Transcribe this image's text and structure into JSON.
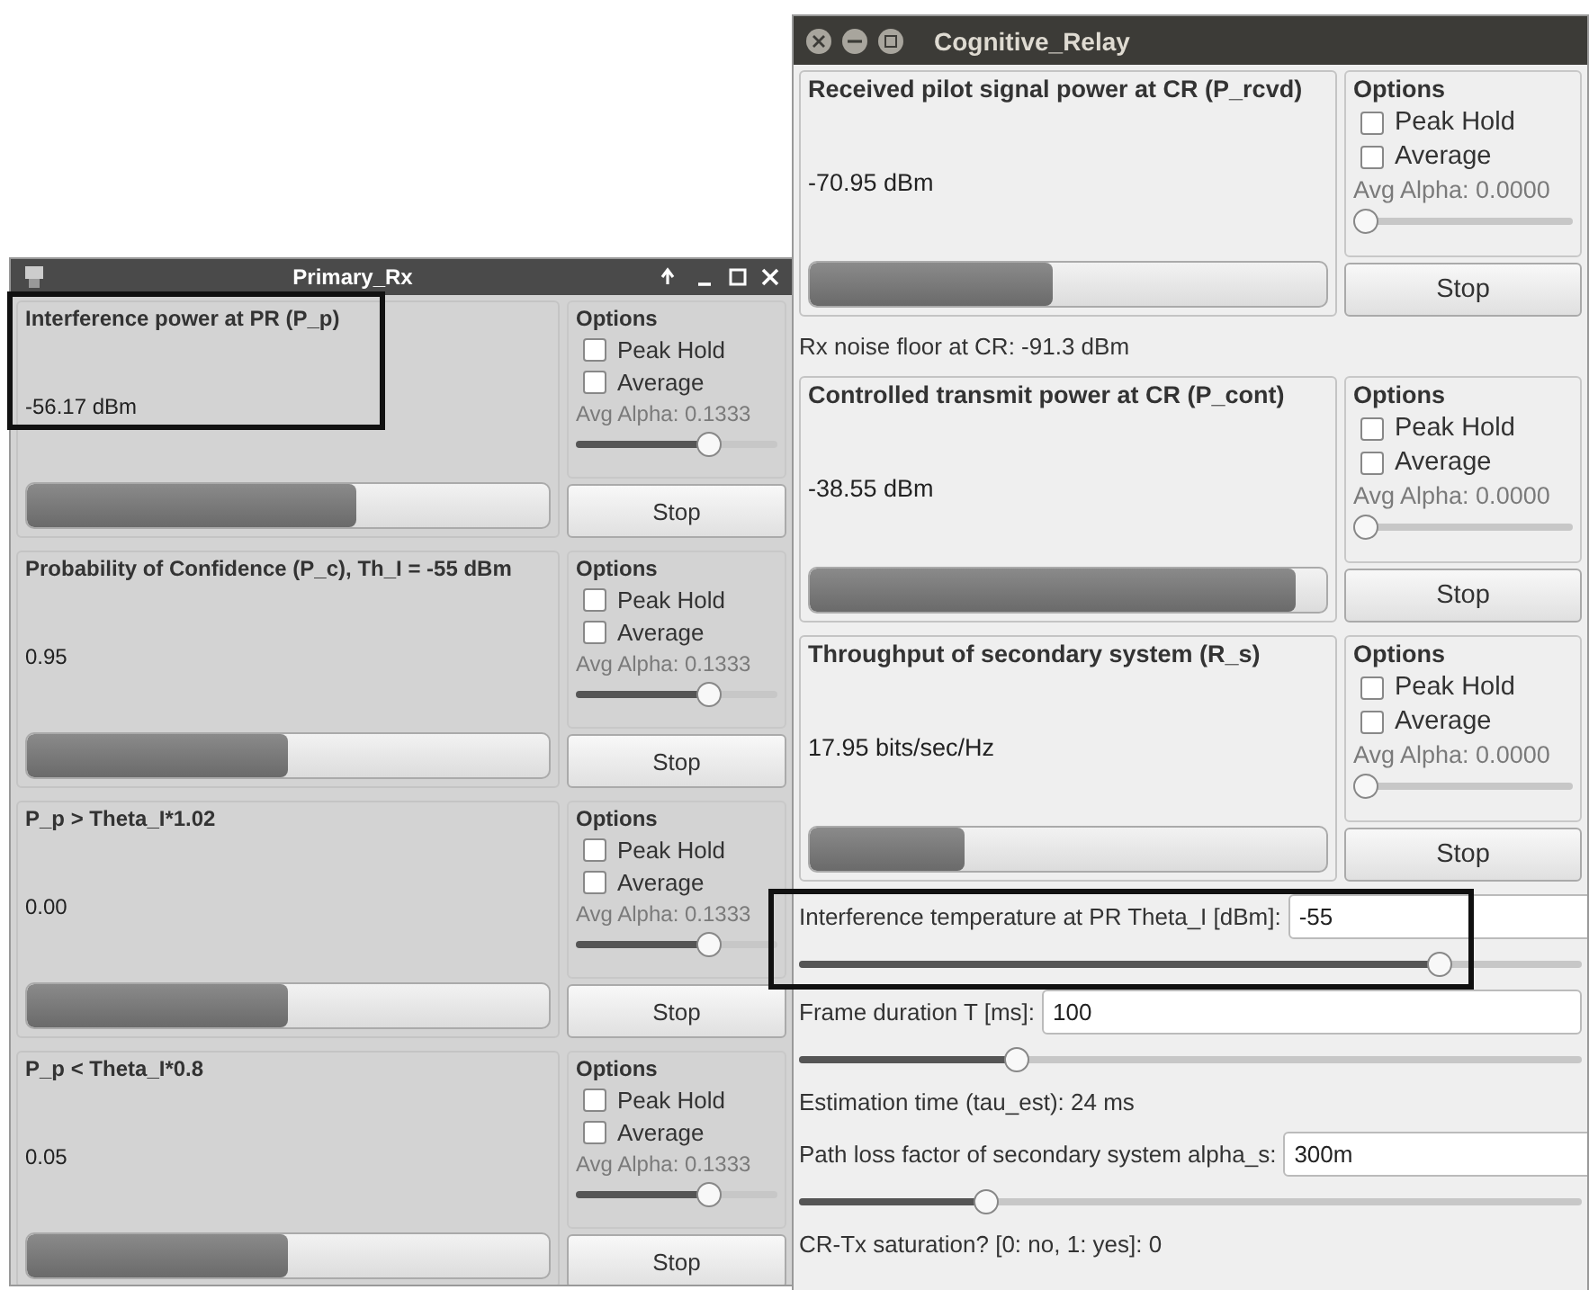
{
  "windows": [
    {
      "title": "Primary_Rx",
      "kind": "qt",
      "items": [
        {
          "kind": "panel",
          "title": "Interference power at PR (P_p)",
          "value": "-56.17 dBm",
          "level": 0.63,
          "options": {
            "title": "Options",
            "checks": [
              {
                "label": "Peak Hold",
                "checked": false
              },
              {
                "label": "Average",
                "checked": false
              }
            ],
            "alpha": "Avg Alpha: 0.1333",
            "alpha_slider": {
              "level": 0.68
            },
            "button": "Stop"
          }
        },
        {
          "kind": "panel",
          "title": "Probability of Confidence (P_c), Th_I = -55 dBm",
          "value": "0.95",
          "level": 0.5,
          "options": {
            "title": "Options",
            "checks": [
              {
                "label": "Peak Hold",
                "checked": false
              },
              {
                "label": "Average",
                "checked": false
              }
            ],
            "alpha": "Avg Alpha: 0.1333",
            "alpha_slider": {
              "level": 0.68
            },
            "button": "Stop"
          }
        },
        {
          "kind": "panel",
          "title": "P_p > Theta_I*1.02",
          "value": "0.00",
          "level": 0.5,
          "options": {
            "title": "Options",
            "checks": [
              {
                "label": "Peak Hold",
                "checked": false
              },
              {
                "label": "Average",
                "checked": false
              }
            ],
            "alpha": "Avg Alpha: 0.1333",
            "alpha_slider": {
              "level": 0.68
            },
            "button": "Stop"
          }
        },
        {
          "kind": "panel",
          "title": "P_p < Theta_I*0.8",
          "value": "0.05",
          "level": 0.5,
          "options": {
            "title": "Options",
            "checks": [
              {
                "label": "Peak Hold",
                "checked": false
              },
              {
                "label": "Average",
                "checked": false
              }
            ],
            "alpha": "Avg Alpha: 0.1333",
            "alpha_slider": {
              "level": 0.68
            },
            "button": "Stop"
          }
        }
      ]
    },
    {
      "title": "Cognitive_Relay",
      "kind": "gtk",
      "items": [
        {
          "kind": "panel",
          "title": "Received pilot signal power at CR (P_rcvd)",
          "value": "-70.95 dBm",
          "level": 0.47,
          "options": {
            "title": "Options",
            "checks": [
              {
                "label": "Peak Hold",
                "checked": false
              },
              {
                "label": "Average",
                "checked": false
              }
            ],
            "alpha": "Avg Alpha: 0.0000",
            "alpha_slider": {
              "level": 0
            },
            "button": "Stop"
          }
        },
        {
          "kind": "text",
          "text": "Rx noise floor at CR: -91.3 dBm"
        },
        {
          "kind": "panel",
          "title": "Controlled transmit power at CR (P_cont)",
          "value": "-38.55 dBm",
          "level": 0.94,
          "options": {
            "title": "Options",
            "checks": [
              {
                "label": "Peak Hold",
                "checked": false
              },
              {
                "label": "Average",
                "checked": false
              }
            ],
            "alpha": "Avg Alpha: 0.0000",
            "alpha_slider": {
              "level": 0
            },
            "button": "Stop"
          }
        },
        {
          "kind": "panel",
          "title": "Throughput of secondary system (R_s)",
          "value": "17.95 bits/sec/Hz",
          "level": 0.3,
          "options": {
            "title": "Options",
            "checks": [
              {
                "label": "Peak Hold",
                "checked": false
              },
              {
                "label": "Average",
                "checked": false
              }
            ],
            "alpha": "Avg Alpha: 0.0000",
            "alpha_slider": {
              "level": 0
            },
            "button": "Stop"
          }
        },
        {
          "kind": "field",
          "label": "Interference temperature at PR Theta_I [dBm]:",
          "value": "-55"
        },
        {
          "kind": "slider",
          "level": 0.83
        },
        {
          "kind": "field",
          "label": "Frame duration T [ms]:",
          "value": "100"
        },
        {
          "kind": "slider",
          "level": 0.27
        },
        {
          "kind": "text",
          "text": "Estimation time (tau_est): 24 ms"
        },
        {
          "kind": "field",
          "label": "Path loss factor of secondary system alpha_s:",
          "value": "300m"
        },
        {
          "kind": "slider",
          "level": 0.23
        },
        {
          "kind": "text",
          "text": "CR-Tx saturation? [0: no, 1: yes]: 0"
        }
      ]
    }
  ]
}
